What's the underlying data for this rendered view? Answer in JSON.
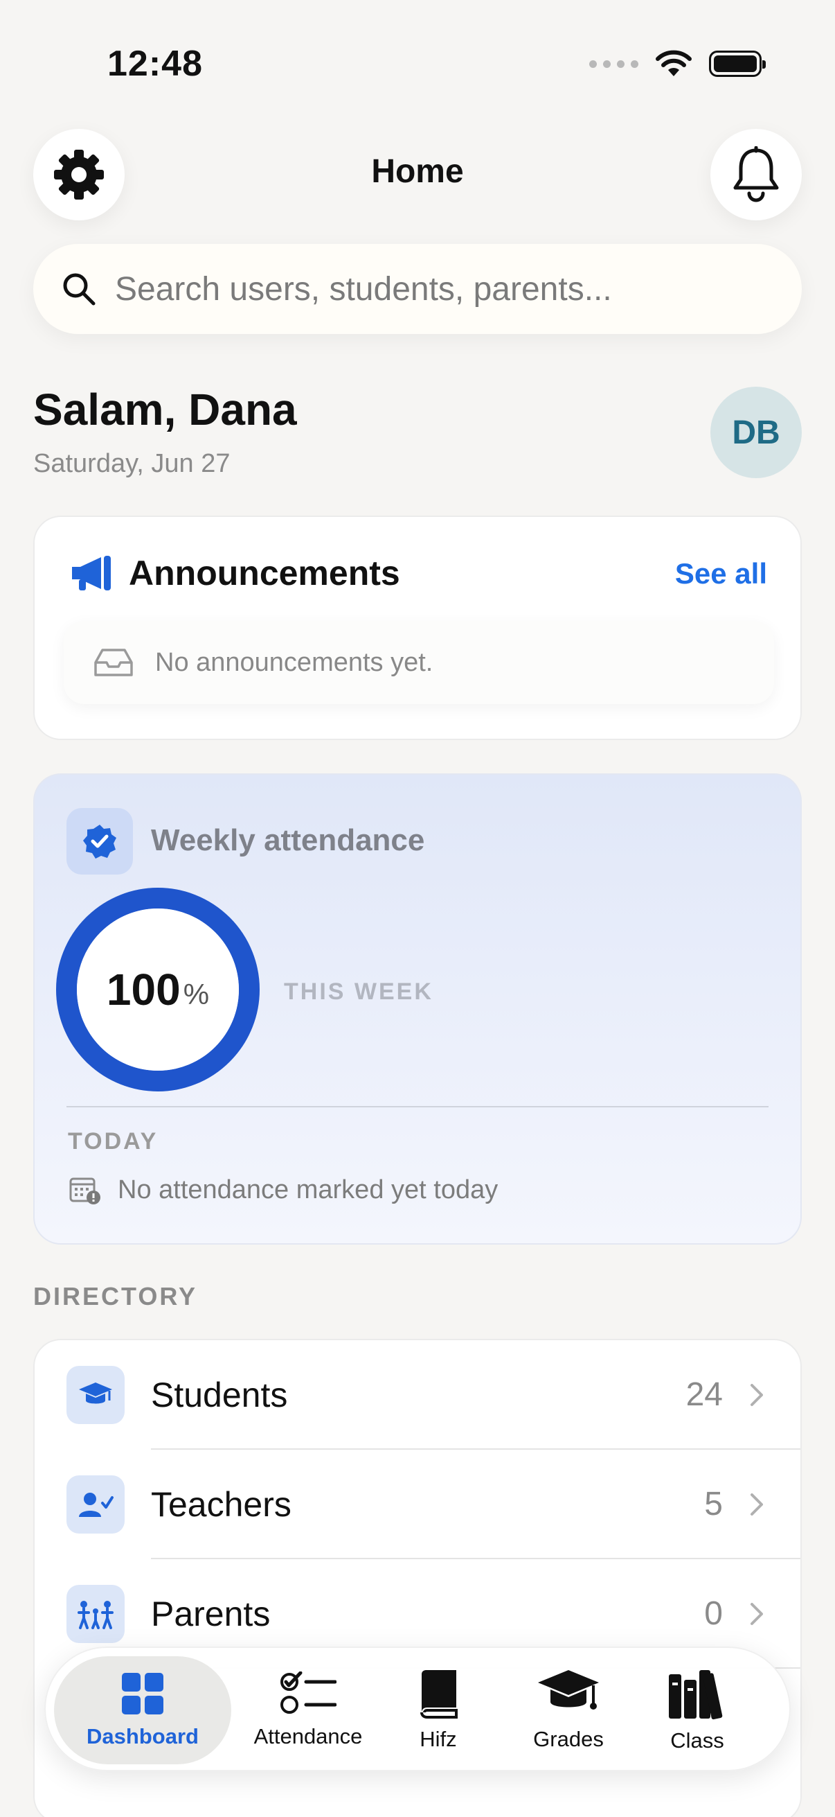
{
  "status_bar": {
    "time": "12:48"
  },
  "header": {
    "title": "Home",
    "settings_icon": "gear-icon",
    "notifications_icon": "bell-icon"
  },
  "search": {
    "placeholder": "Search users, students, parents..."
  },
  "greeting": {
    "text": "Salam, Dana",
    "date": "Saturday, Jun 27",
    "avatar_initials": "DB"
  },
  "announcements": {
    "title": "Announcements",
    "see_all": "See all",
    "empty_text": "No announcements yet."
  },
  "attendance": {
    "title": "Weekly attendance",
    "percent_value": "100",
    "percent_sign": "%",
    "percent": 100,
    "period_label": "THIS WEEK",
    "today_label": "TODAY",
    "today_text": "No attendance marked yet today"
  },
  "directory": {
    "label": "DIRECTORY",
    "items": [
      {
        "name": "Students",
        "count": "24",
        "icon": "graduation-cap-icon"
      },
      {
        "name": "Teachers",
        "count": "5",
        "icon": "teacher-icon"
      },
      {
        "name": "Parents",
        "count": "0",
        "icon": "family-icon"
      }
    ]
  },
  "tabs": [
    {
      "label": "Dashboard",
      "icon": "grid-icon",
      "active": true
    },
    {
      "label": "Attendance",
      "icon": "checklist-icon",
      "active": false
    },
    {
      "label": "Hifz",
      "icon": "book-icon",
      "active": false
    },
    {
      "label": "Grades",
      "icon": "mortarboard-icon",
      "active": false
    },
    {
      "label": "Class",
      "icon": "books-icon",
      "active": false
    }
  ],
  "colors": {
    "accent": "#1f63d8",
    "link": "#1f6fe6",
    "avatar_text": "#1f6b86"
  }
}
